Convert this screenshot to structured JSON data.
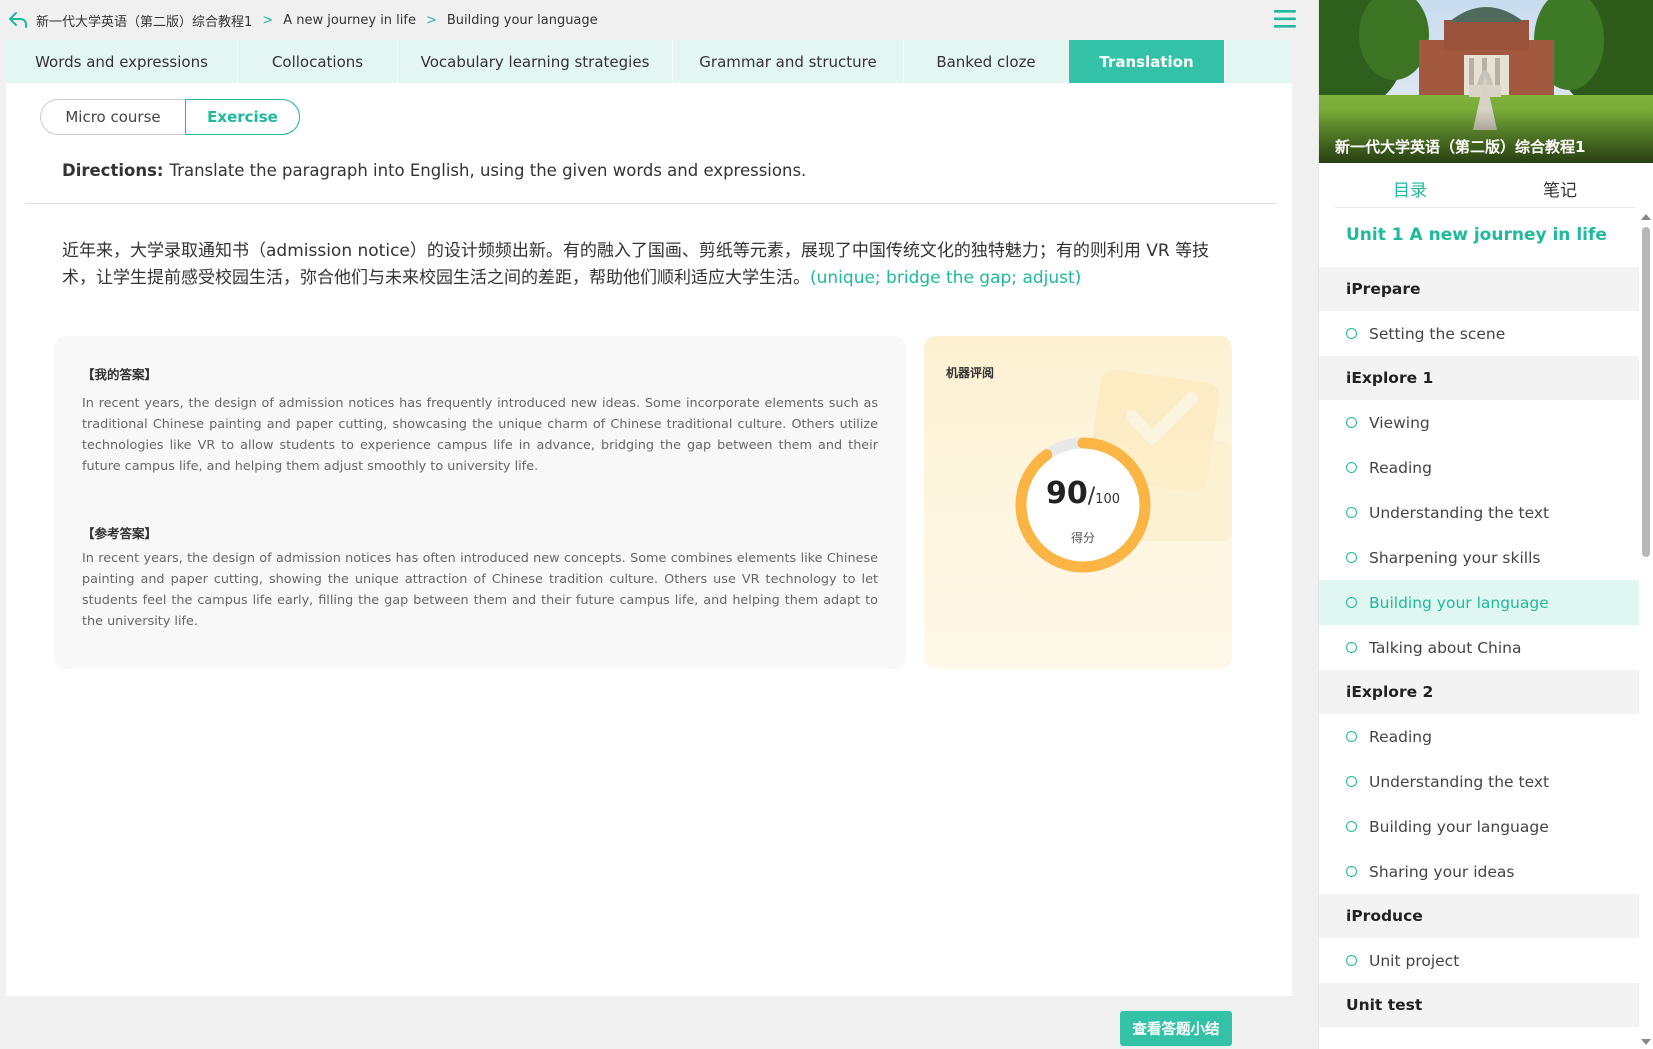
{
  "breadcrumb": {
    "items": [
      "新一代大学英语（第二版）综合教程1",
      "A new journey in life",
      "Building your language"
    ],
    "separator": ">"
  },
  "tabs": [
    {
      "label": "Words and expressions",
      "active": false
    },
    {
      "label": "Collocations",
      "active": false
    },
    {
      "label": "Vocabulary learning strategies",
      "active": false
    },
    {
      "label": "Grammar and structure",
      "active": false
    },
    {
      "label": "Banked cloze",
      "active": false
    },
    {
      "label": "Translation",
      "active": true
    }
  ],
  "mode": {
    "micro_label": "Micro course",
    "exercise_label": "Exercise",
    "selected": "Exercise"
  },
  "directions": {
    "label": "Directions:",
    "text": "Translate the paragraph into English, using the given words and expressions."
  },
  "prompt": {
    "text": "近年来，大学录取通知书（admission notice）的设计频频出新。有的融入了国画、剪纸等元素，展现了中国传统文化的独特魅力；有的则利用 VR 等技术，让学生提前感受校园生活，弥合他们与未来校园生活之间的差距，帮助他们顺利适应大学生活。",
    "hint": "(unique; bridge the gap; adjust)"
  },
  "my_answer": {
    "title": "【我的答案】",
    "text": "In recent years, the design of admission notices has frequently introduced new ideas. Some incorporate elements such as traditional Chinese painting and paper cutting, showcasing the unique charm of Chinese traditional culture. Others utilize technologies like VR to allow students to experience campus life in advance, bridging the gap between them and their future campus life, and helping them adjust smoothly to university life."
  },
  "reference_answer": {
    "title": "【参考答案】",
    "text": "In recent years, the design of admission notices has often introduced new concepts. Some combines elements like Chinese painting and paper cutting, showing the unique attraction of Chinese tradition culture. Others use VR technology to let students feel the campus life early, filling the gap between them and their future campus life, and helping them adapt to the university life."
  },
  "score": {
    "title": "机器评阅",
    "value": "90",
    "max": "100",
    "label": "得分",
    "fraction": 0.9
  },
  "footer": {
    "summary_label": "查看答题小结"
  },
  "sidebar": {
    "cover_title": "新一代大学英语（第二版）综合教程1",
    "tabs": [
      {
        "label": "目录",
        "active": true
      },
      {
        "label": "笔记",
        "active": false
      }
    ],
    "unit_title": "Unit 1 A new journey in life",
    "toc": [
      {
        "type": "section",
        "label": "iPrepare"
      },
      {
        "type": "item",
        "label": "Setting the scene"
      },
      {
        "type": "section",
        "label": "iExplore 1"
      },
      {
        "type": "item",
        "label": "Viewing"
      },
      {
        "type": "item",
        "label": "Reading"
      },
      {
        "type": "item",
        "label": "Understanding the text"
      },
      {
        "type": "item",
        "label": "Sharpening your skills"
      },
      {
        "type": "item",
        "label": "Building your language",
        "active": true
      },
      {
        "type": "item",
        "label": "Talking about China"
      },
      {
        "type": "section",
        "label": "iExplore 2"
      },
      {
        "type": "item",
        "label": "Reading"
      },
      {
        "type": "item",
        "label": "Understanding the text"
      },
      {
        "type": "item",
        "label": "Building your language"
      },
      {
        "type": "item",
        "label": "Sharing your ideas"
      },
      {
        "type": "section",
        "label": "iProduce"
      },
      {
        "type": "item",
        "label": "Unit project"
      },
      {
        "type": "section",
        "label": "Unit test"
      }
    ]
  },
  "colors": {
    "accent": "#1fb99c",
    "accent_fill": "#33c2a7",
    "tab_bg": "#e3f6f1",
    "score_ring": "#fbb544"
  },
  "icons": {
    "back": "back-arrow-icon",
    "menu": "hamburger-menu-icon"
  }
}
